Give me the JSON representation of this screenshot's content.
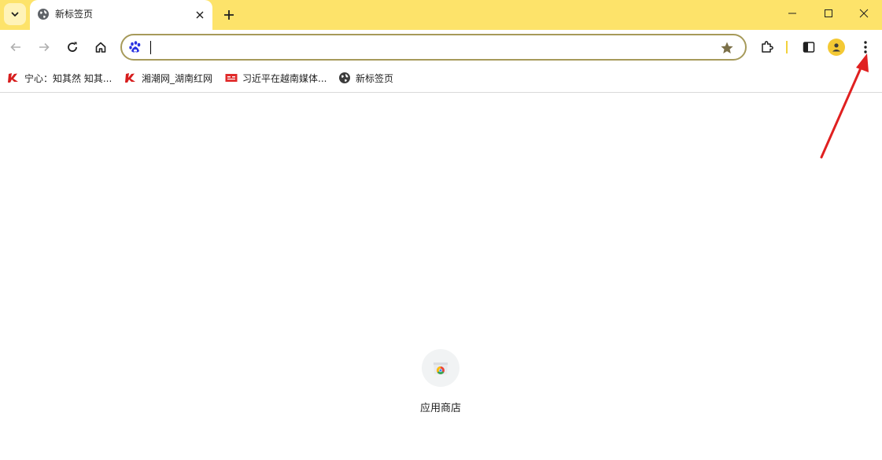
{
  "tab": {
    "title": "新标签页",
    "favicon": "globe-icon"
  },
  "window_controls": [
    "minimize-icon",
    "maximize-icon",
    "close-icon"
  ],
  "toolbar": {
    "icons": [
      "back-arrow-icon",
      "forward-arrow-icon",
      "reload-icon",
      "home-icon",
      "extensions-icon",
      "side-panel-icon",
      "profile-icon",
      "more-menu-icon"
    ]
  },
  "omnibox": {
    "value": "",
    "search_engine_icon": "baidu-paw-icon",
    "bookmark_icon": "star-icon"
  },
  "bookmarks": [
    {
      "label": "宁心：知其然 知其...",
      "icon": "red-news-icon"
    },
    {
      "label": "湘潮网_湖南红网",
      "icon": "red-news-icon"
    },
    {
      "label": "习近平在越南媒体...",
      "icon": "red-badge-icon"
    },
    {
      "label": "新标签页",
      "icon": "globe-icon"
    }
  ],
  "shortcuts": [
    {
      "label": "应用商店",
      "icon": "chrome-web-store-icon"
    }
  ],
  "annotation": {
    "type": "red-arrow",
    "target": "more-menu-icon"
  },
  "colors": {
    "tabstrip": "#fde36a",
    "omnibox_border": "#a69a5a",
    "avatar": "#f4c934",
    "arrow": "#e02020"
  }
}
